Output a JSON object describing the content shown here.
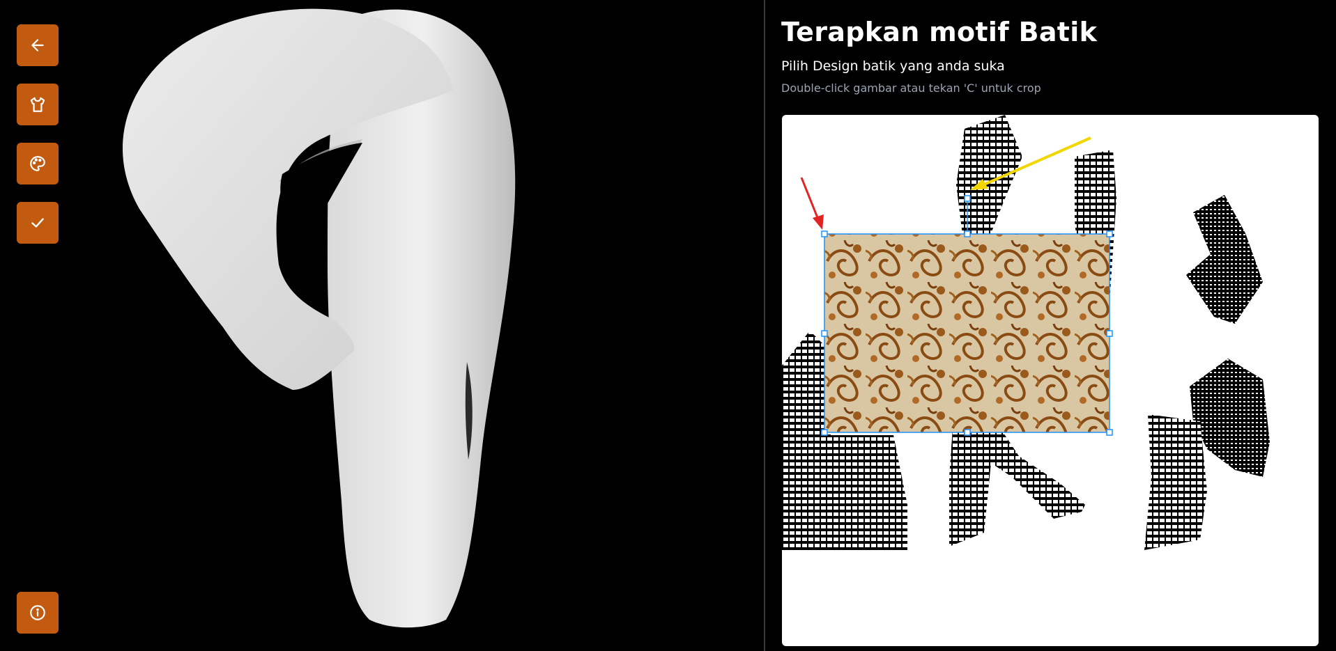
{
  "toolbar": {
    "buttons": [
      {
        "name": "back-button",
        "icon": "arrow-left-icon"
      },
      {
        "name": "garment-button",
        "icon": "shirt-icon"
      },
      {
        "name": "palette-button",
        "icon": "palette-icon"
      },
      {
        "name": "confirm-button",
        "icon": "check-icon"
      }
    ],
    "info_icon": "info-icon",
    "accent_color": "#c25b10"
  },
  "panel": {
    "title": "Terapkan motif Batik",
    "subtitle": "Pilih Design batik yang anda suka",
    "hint": "Double-click gambar atau tekan 'C' untuk crop"
  },
  "editor": {
    "selection_color": "#1e90ff",
    "annotation_colors": {
      "red_arrow": "#e02424",
      "yellow_arrow": "#f2d600"
    }
  }
}
